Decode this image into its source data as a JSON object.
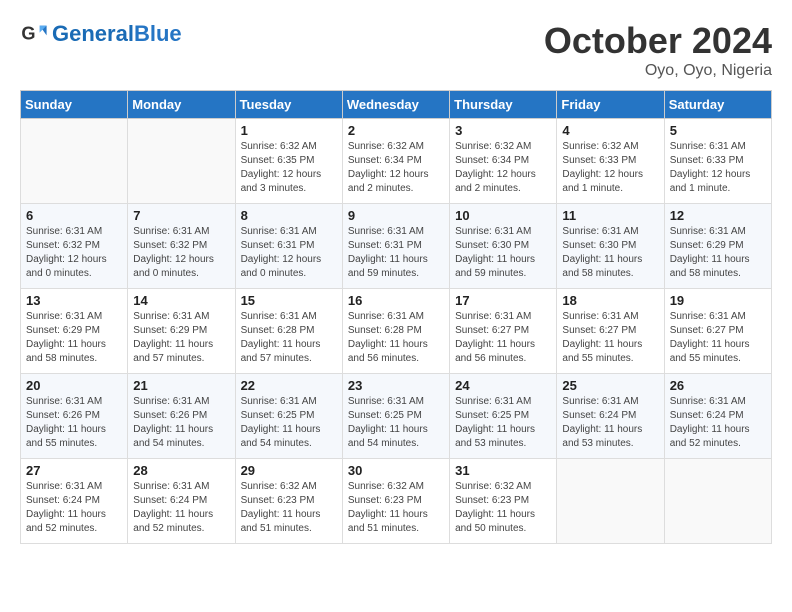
{
  "header": {
    "logo_general": "General",
    "logo_blue": "Blue",
    "month": "October 2024",
    "location": "Oyo, Oyo, Nigeria"
  },
  "weekdays": [
    "Sunday",
    "Monday",
    "Tuesday",
    "Wednesday",
    "Thursday",
    "Friday",
    "Saturday"
  ],
  "weeks": [
    [
      {
        "day": "",
        "info": ""
      },
      {
        "day": "",
        "info": ""
      },
      {
        "day": "1",
        "info": "Sunrise: 6:32 AM\nSunset: 6:35 PM\nDaylight: 12 hours and 3 minutes."
      },
      {
        "day": "2",
        "info": "Sunrise: 6:32 AM\nSunset: 6:34 PM\nDaylight: 12 hours and 2 minutes."
      },
      {
        "day": "3",
        "info": "Sunrise: 6:32 AM\nSunset: 6:34 PM\nDaylight: 12 hours and 2 minutes."
      },
      {
        "day": "4",
        "info": "Sunrise: 6:32 AM\nSunset: 6:33 PM\nDaylight: 12 hours and 1 minute."
      },
      {
        "day": "5",
        "info": "Sunrise: 6:31 AM\nSunset: 6:33 PM\nDaylight: 12 hours and 1 minute."
      }
    ],
    [
      {
        "day": "6",
        "info": "Sunrise: 6:31 AM\nSunset: 6:32 PM\nDaylight: 12 hours and 0 minutes."
      },
      {
        "day": "7",
        "info": "Sunrise: 6:31 AM\nSunset: 6:32 PM\nDaylight: 12 hours and 0 minutes."
      },
      {
        "day": "8",
        "info": "Sunrise: 6:31 AM\nSunset: 6:31 PM\nDaylight: 12 hours and 0 minutes."
      },
      {
        "day": "9",
        "info": "Sunrise: 6:31 AM\nSunset: 6:31 PM\nDaylight: 11 hours and 59 minutes."
      },
      {
        "day": "10",
        "info": "Sunrise: 6:31 AM\nSunset: 6:30 PM\nDaylight: 11 hours and 59 minutes."
      },
      {
        "day": "11",
        "info": "Sunrise: 6:31 AM\nSunset: 6:30 PM\nDaylight: 11 hours and 58 minutes."
      },
      {
        "day": "12",
        "info": "Sunrise: 6:31 AM\nSunset: 6:29 PM\nDaylight: 11 hours and 58 minutes."
      }
    ],
    [
      {
        "day": "13",
        "info": "Sunrise: 6:31 AM\nSunset: 6:29 PM\nDaylight: 11 hours and 58 minutes."
      },
      {
        "day": "14",
        "info": "Sunrise: 6:31 AM\nSunset: 6:29 PM\nDaylight: 11 hours and 57 minutes."
      },
      {
        "day": "15",
        "info": "Sunrise: 6:31 AM\nSunset: 6:28 PM\nDaylight: 11 hours and 57 minutes."
      },
      {
        "day": "16",
        "info": "Sunrise: 6:31 AM\nSunset: 6:28 PM\nDaylight: 11 hours and 56 minutes."
      },
      {
        "day": "17",
        "info": "Sunrise: 6:31 AM\nSunset: 6:27 PM\nDaylight: 11 hours and 56 minutes."
      },
      {
        "day": "18",
        "info": "Sunrise: 6:31 AM\nSunset: 6:27 PM\nDaylight: 11 hours and 55 minutes."
      },
      {
        "day": "19",
        "info": "Sunrise: 6:31 AM\nSunset: 6:27 PM\nDaylight: 11 hours and 55 minutes."
      }
    ],
    [
      {
        "day": "20",
        "info": "Sunrise: 6:31 AM\nSunset: 6:26 PM\nDaylight: 11 hours and 55 minutes."
      },
      {
        "day": "21",
        "info": "Sunrise: 6:31 AM\nSunset: 6:26 PM\nDaylight: 11 hours and 54 minutes."
      },
      {
        "day": "22",
        "info": "Sunrise: 6:31 AM\nSunset: 6:25 PM\nDaylight: 11 hours and 54 minutes."
      },
      {
        "day": "23",
        "info": "Sunrise: 6:31 AM\nSunset: 6:25 PM\nDaylight: 11 hours and 54 minutes."
      },
      {
        "day": "24",
        "info": "Sunrise: 6:31 AM\nSunset: 6:25 PM\nDaylight: 11 hours and 53 minutes."
      },
      {
        "day": "25",
        "info": "Sunrise: 6:31 AM\nSunset: 6:24 PM\nDaylight: 11 hours and 53 minutes."
      },
      {
        "day": "26",
        "info": "Sunrise: 6:31 AM\nSunset: 6:24 PM\nDaylight: 11 hours and 52 minutes."
      }
    ],
    [
      {
        "day": "27",
        "info": "Sunrise: 6:31 AM\nSunset: 6:24 PM\nDaylight: 11 hours and 52 minutes."
      },
      {
        "day": "28",
        "info": "Sunrise: 6:31 AM\nSunset: 6:24 PM\nDaylight: 11 hours and 52 minutes."
      },
      {
        "day": "29",
        "info": "Sunrise: 6:32 AM\nSunset: 6:23 PM\nDaylight: 11 hours and 51 minutes."
      },
      {
        "day": "30",
        "info": "Sunrise: 6:32 AM\nSunset: 6:23 PM\nDaylight: 11 hours and 51 minutes."
      },
      {
        "day": "31",
        "info": "Sunrise: 6:32 AM\nSunset: 6:23 PM\nDaylight: 11 hours and 50 minutes."
      },
      {
        "day": "",
        "info": ""
      },
      {
        "day": "",
        "info": ""
      }
    ]
  ]
}
